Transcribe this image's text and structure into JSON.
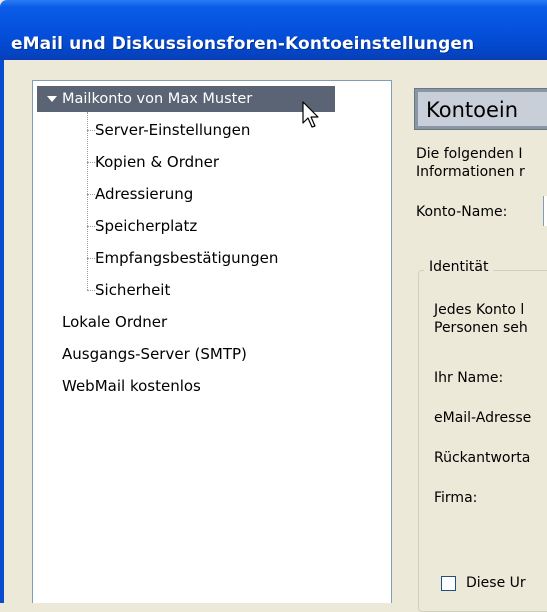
{
  "window": {
    "title": "eMail und Diskussionsforen-Kontoeinstellungen"
  },
  "tree": {
    "account": "Mailkonto von Max Muster",
    "children": [
      "Server-Einstellungen",
      "Kopien & Ordner",
      "Adressierung",
      "Speicherplatz",
      "Empfangsbestätigungen",
      "Sicherheit"
    ],
    "other": [
      "Lokale Ordner",
      "Ausgangs-Server (SMTP)",
      "WebMail kostenlos"
    ]
  },
  "panel": {
    "header": "Kontoein",
    "intro_line1": "Die folgenden I",
    "intro_line2": "Informationen r",
    "konto_name_label": "Konto-Name:",
    "identity_legend": "Identität",
    "identity_text1": "Jedes Konto l",
    "identity_text2": "Personen seh",
    "name_label": "Ihr Name:",
    "email_label": "eMail-Adresse",
    "reply_label": "Rückantworta",
    "company_label": "Firma:",
    "checkbox_label": "Diese Ur"
  },
  "colors": {
    "titlebar": "#0551DE",
    "selection": "#5A6475",
    "panel_header": "#C9CFD8"
  }
}
